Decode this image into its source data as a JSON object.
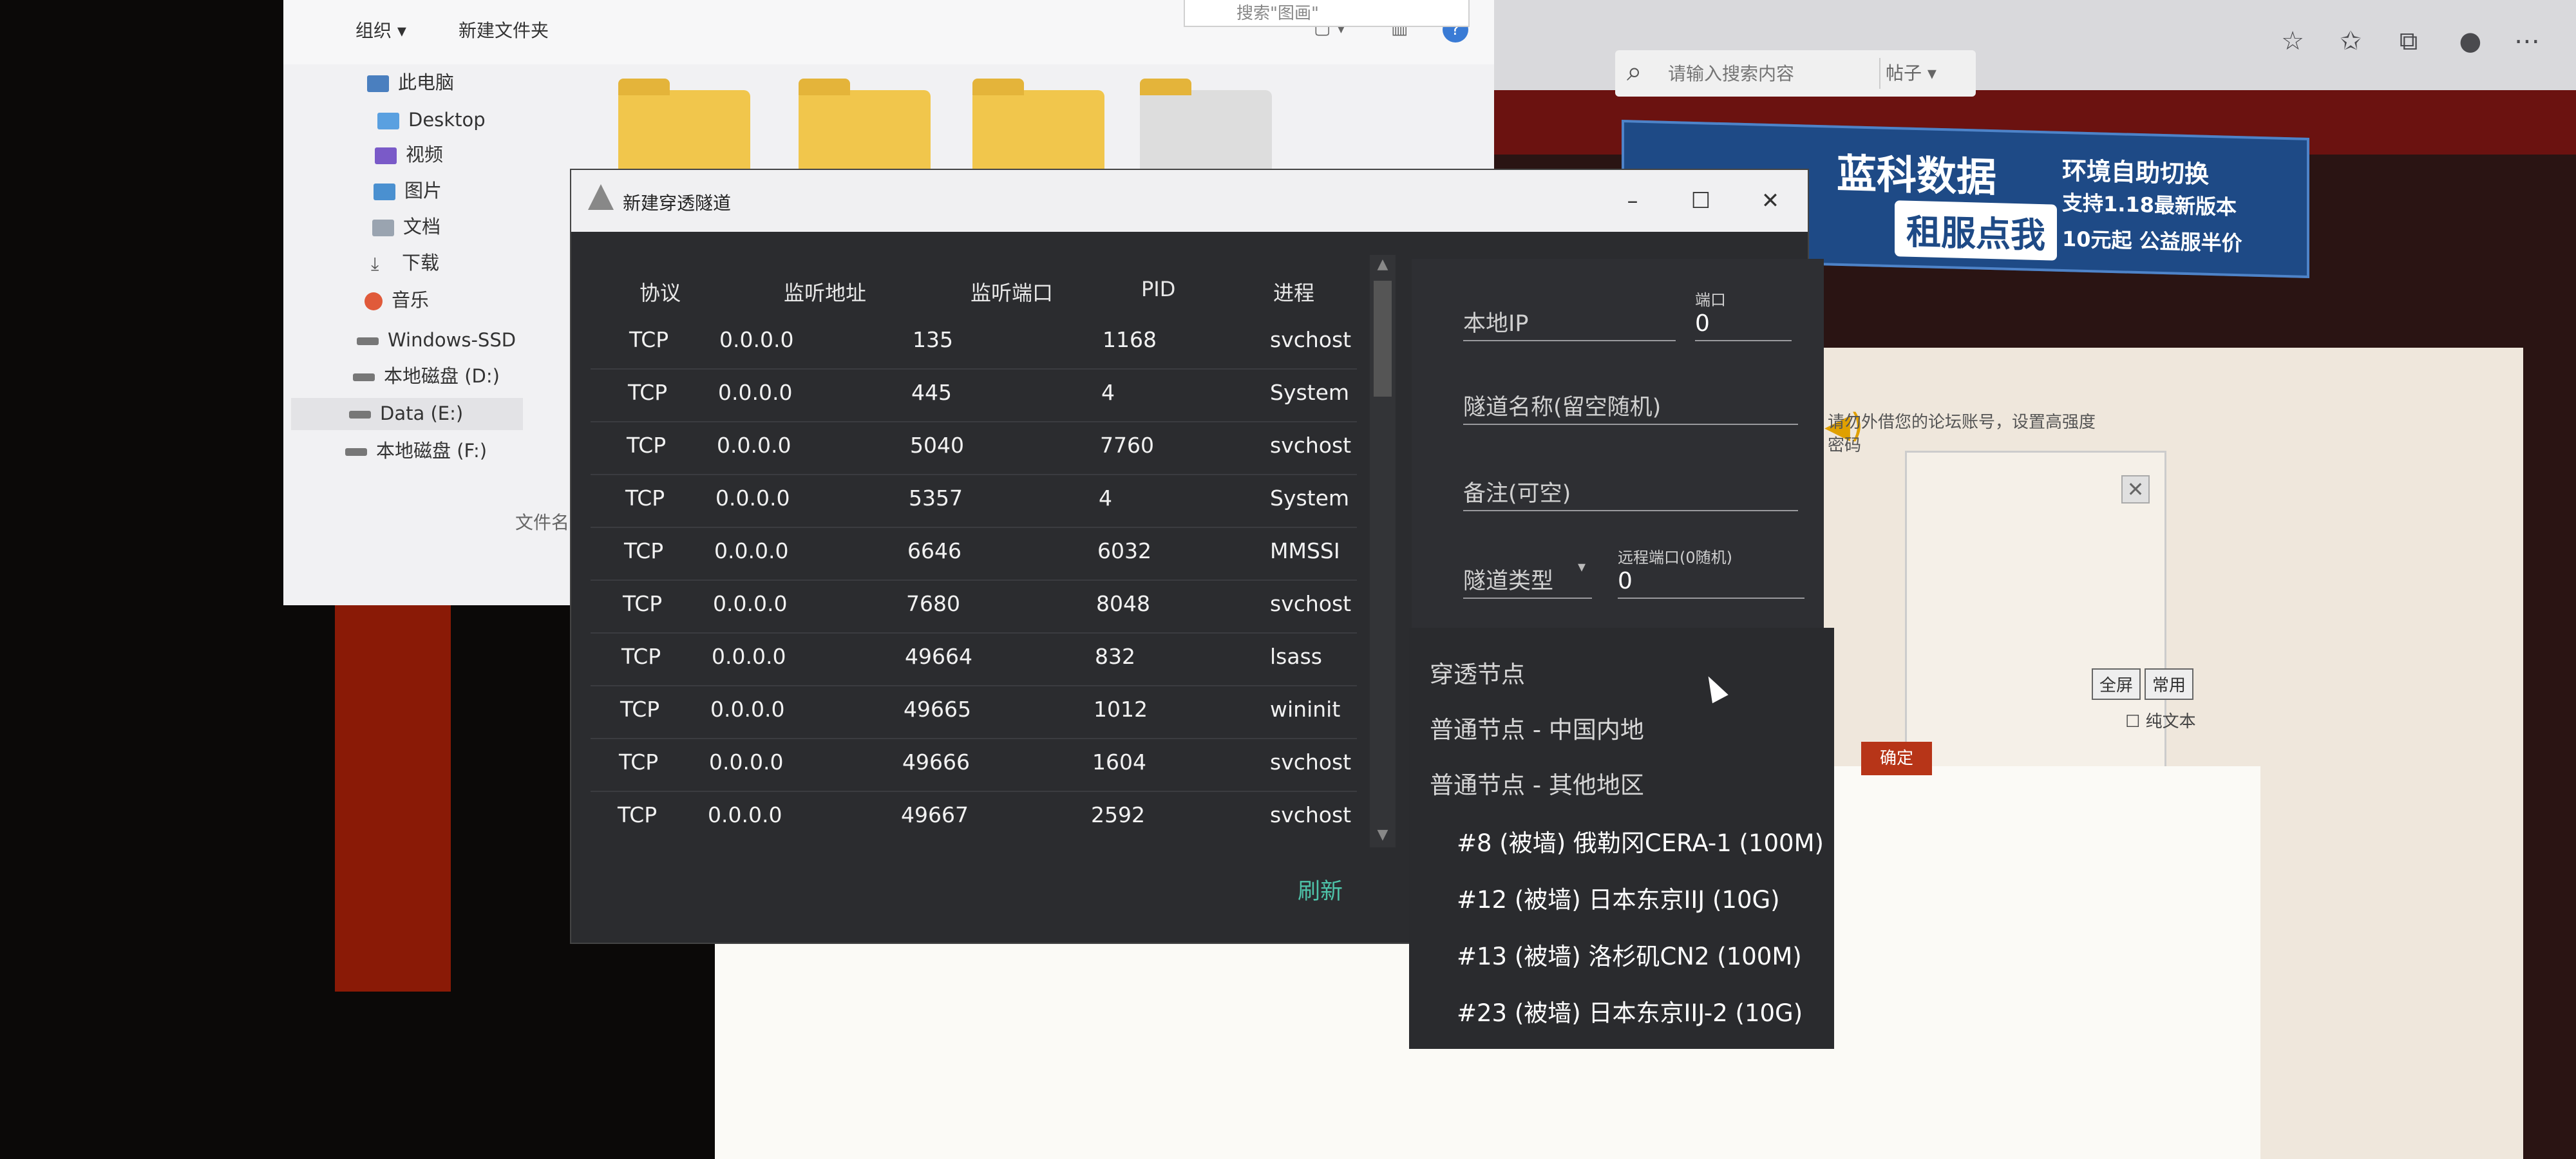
{
  "browser": {
    "search_placeholder": "请输入搜索内容",
    "search_scope": "帖子",
    "banner": {
      "brand": "蓝科数据",
      "cta": "租服点我",
      "line1": "环境自助切换",
      "line2": "支持1.18最新版本",
      "line3": "10元起 公益服半价"
    },
    "forum": {
      "notice": "请勿外借您的论坛账号，设置高强度密码",
      "confirm_label": "确定",
      "fullscreen_label": "全屏",
      "common_label": "常用",
      "plain_text_label": "纯文本"
    }
  },
  "explorer": {
    "toolbar": {
      "organize": "组织",
      "new_folder": "新建文件夹",
      "search": "搜索\"图画\""
    },
    "nav": [
      {
        "label": "此电脑",
        "icon": "computer-icon"
      },
      {
        "label": "Desktop",
        "icon": "desktop-folder-icon"
      },
      {
        "label": "视频",
        "icon": "video-icon"
      },
      {
        "label": "图片",
        "icon": "image-icon"
      },
      {
        "label": "文档",
        "icon": "document-icon"
      },
      {
        "label": "下载",
        "icon": "download-icon"
      },
      {
        "label": "音乐",
        "icon": "music-icon"
      },
      {
        "label": "Windows-SSD",
        "icon": "drive-icon"
      },
      {
        "label": "本地磁盘 (D:)",
        "icon": "drive-icon"
      },
      {
        "label": "Data (E:)",
        "icon": "drive-icon"
      },
      {
        "label": "本地磁盘 (F:)",
        "icon": "drive-icon"
      }
    ],
    "file_name_label": "文件名(N"
  },
  "dialog": {
    "title": "新建穿透隧道",
    "columns": [
      "协议",
      "监听地址",
      "监听端口",
      "PID",
      "进程"
    ],
    "rows": [
      [
        "TCP",
        "0.0.0.0",
        "135",
        "1168",
        "svchost"
      ],
      [
        "TCP",
        "0.0.0.0",
        "445",
        "4",
        "System"
      ],
      [
        "TCP",
        "0.0.0.0",
        "5040",
        "7760",
        "svchost"
      ],
      [
        "TCP",
        "0.0.0.0",
        "5357",
        "4",
        "System"
      ],
      [
        "TCP",
        "0.0.0.0",
        "6646",
        "6032",
        "MMSSI"
      ],
      [
        "TCP",
        "0.0.0.0",
        "7680",
        "8048",
        "svchost"
      ],
      [
        "TCP",
        "0.0.0.0",
        "49664",
        "832",
        "lsass"
      ],
      [
        "TCP",
        "0.0.0.0",
        "49665",
        "1012",
        "wininit"
      ],
      [
        "TCP",
        "0.0.0.0",
        "49666",
        "1604",
        "svchost"
      ],
      [
        "TCP",
        "0.0.0.0",
        "49667",
        "2592",
        "svchost"
      ]
    ],
    "refresh_label": "刷新",
    "form": {
      "local_ip_label": "本地IP",
      "port_label": "端口",
      "port_value": "0",
      "tunnel_name_label": "隧道名称(留空随机)",
      "remark_label": "备注(可空)",
      "tunnel_type_label": "隧道类型",
      "remote_port_label": "远程端口(0随机)",
      "remote_port_value": "0"
    },
    "dropdown": {
      "items": [
        {
          "label": "穿透节点"
        },
        {
          "label": "普通节点 - 中国内地"
        },
        {
          "label": "普通节点 - 其他地区"
        },
        {
          "label": "#8 (被墙) 俄勒冈CERA-1 (100M)"
        },
        {
          "label": "#12 (被墙) 日本东京IIJ (10G)"
        },
        {
          "label": "#13 (被墙) 洛杉矶CN2 (100M)"
        },
        {
          "label": "#23 (被墙) 日本东京IIJ-2 (10G)"
        }
      ]
    }
  }
}
